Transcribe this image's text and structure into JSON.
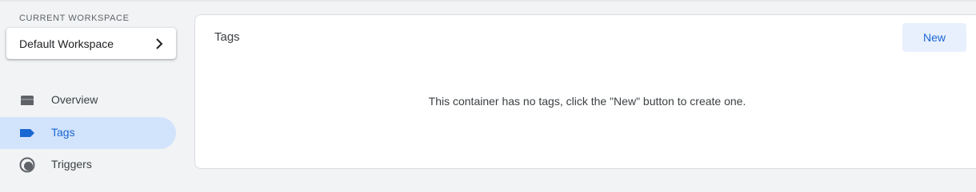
{
  "sidebar": {
    "workspace_label": "CURRENT WORKSPACE",
    "workspace_name": "Default Workspace",
    "items": [
      {
        "label": "Overview",
        "icon": "folder-icon",
        "active": false
      },
      {
        "label": "Tags",
        "icon": "tag-icon",
        "active": true
      },
      {
        "label": "Triggers",
        "icon": "trigger-icon",
        "active": false
      }
    ]
  },
  "main": {
    "title": "Tags",
    "new_button": "New",
    "empty_message": "This container has no tags, click the \"New\" button to create one."
  },
  "colors": {
    "accent": "#1967d2",
    "active_bg": "#d2e3fc",
    "button_bg": "#e8f0fe",
    "page_bg": "#f1f3f4"
  }
}
